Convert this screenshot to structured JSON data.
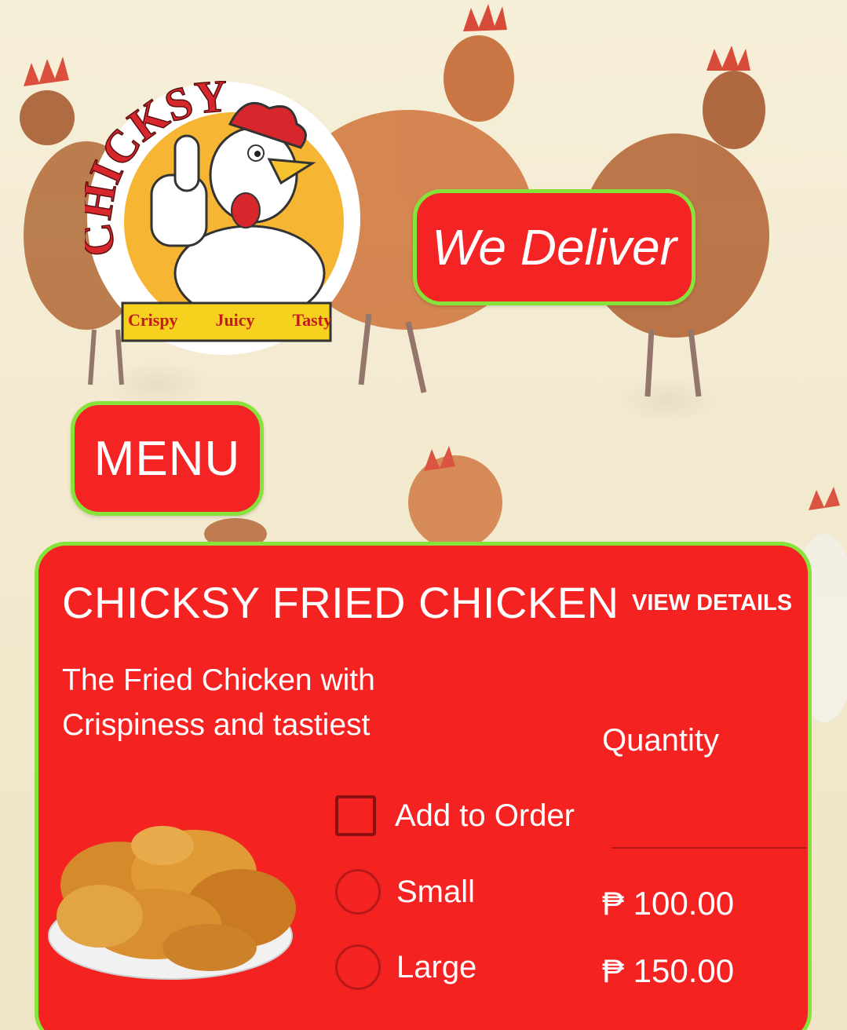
{
  "logo": {
    "brand": "CHICKSY",
    "tagline_words": [
      "Crispy",
      "Juicy",
      "Tasty"
    ]
  },
  "banner": {
    "label": "We Deliver"
  },
  "menu_button": {
    "label": "MENU"
  },
  "card": {
    "title": "CHICKSY FRIED CHICKEN",
    "view_details": "VIEW DETAILS",
    "description": "The Fried Chicken with Crispiness and tastiest",
    "quantity_label": "Quantity",
    "quantity_value": "",
    "add_to_order": "Add to Order",
    "options": [
      {
        "label": "Small",
        "price": "₱ 100.00"
      },
      {
        "label": "Large",
        "price": "₱ 150.00"
      }
    ]
  },
  "colors": {
    "accent_red": "#f52222",
    "border_green": "#86e33a",
    "background": "#f3ead0"
  },
  "icons": [
    "chicken-mascot-logo",
    "fried-chicken-photo",
    "checkbox",
    "radio-button"
  ]
}
